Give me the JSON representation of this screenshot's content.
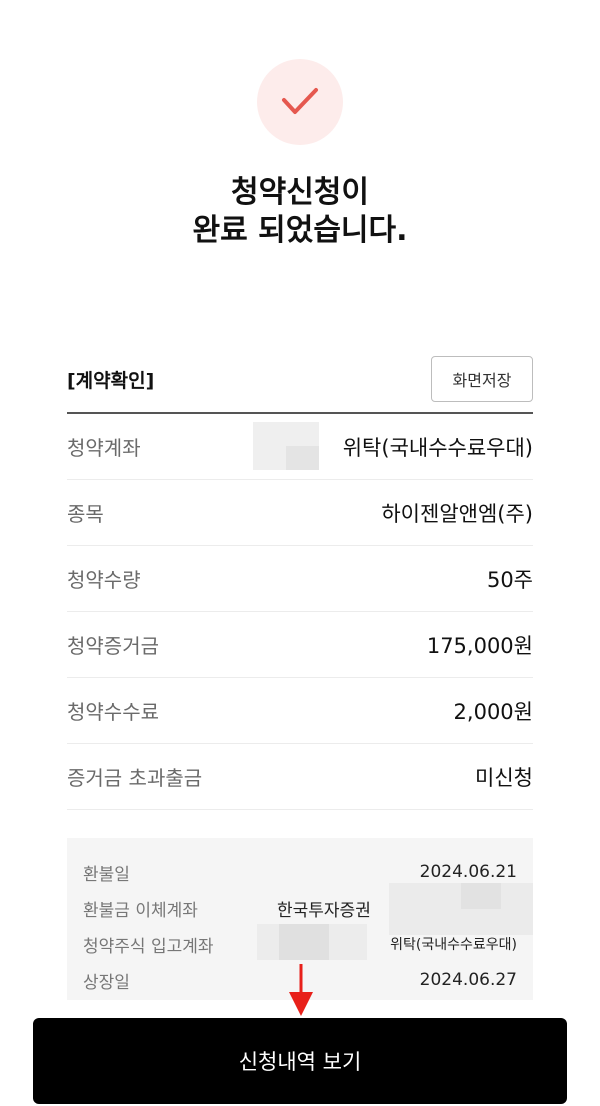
{
  "colors": {
    "accent": "#e5584f",
    "accent_bg": "#fdeceb",
    "button_bg": "#000000",
    "arrow": "#e8201a"
  },
  "icons": {
    "check": "check-icon",
    "arrow": "arrow-down-icon"
  },
  "title": {
    "line1": "청약신청이",
    "line2": "완료 되었습니다."
  },
  "section": {
    "title": "[계약확인]",
    "save_label": "화면저장"
  },
  "rows": [
    {
      "label": "청약계좌",
      "value": "위탁(국내수수료우대)"
    },
    {
      "label": "종목",
      "value": "하이젠알앤엠(주)"
    },
    {
      "label": "청약수량",
      "value": "50주"
    },
    {
      "label": "청약증거금",
      "value": "175,000원"
    },
    {
      "label": "청약수수료",
      "value": "2,000원"
    },
    {
      "label": "증거금 초과출금",
      "value": "미신청"
    }
  ],
  "info": [
    {
      "label": "환불일",
      "value": "2024.06.21"
    },
    {
      "label": "환불금 이체계좌",
      "value": "한국투자증권"
    },
    {
      "label": "청약주식 입고계좌",
      "value": "위탁(국내수수료우대)"
    },
    {
      "label": "상장일",
      "value": "2024.06.27"
    }
  ],
  "cta": {
    "label": "신청내역 보기"
  }
}
